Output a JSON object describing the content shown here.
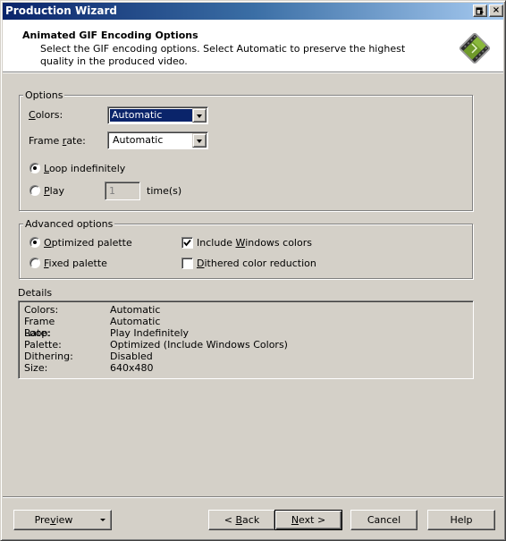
{
  "window": {
    "title": "Production Wizard",
    "restore_label": "restore",
    "close_label": "×"
  },
  "header": {
    "title": "Animated GIF Encoding Options",
    "description": "Select the GIF encoding options. Select Automatic to preserve the highest quality in the produced video.",
    "icon": "film-clip-icon"
  },
  "options": {
    "legend": "Options",
    "colors_label_accel": "C",
    "colors_label_rest": "olors:",
    "colors_value": "Automatic",
    "frame_rate_label_pre": "Frame ",
    "frame_rate_label_accel": "r",
    "frame_rate_label_rest": "ate:",
    "frame_rate_value": "Automatic",
    "loop_accel": "L",
    "loop_rest": "oop indefinitely",
    "loop_selected": true,
    "play_accel": "P",
    "play_rest": "lay",
    "play_selected": false,
    "play_times_value": "1",
    "times_suffix": "time(s)"
  },
  "advanced": {
    "legend": "Advanced options",
    "optimized_accel": "O",
    "optimized_rest": "ptimized palette",
    "optimized_selected": true,
    "fixed_accel": "F",
    "fixed_rest": "ixed palette",
    "fixed_selected": false,
    "include_windows_pre": "Include ",
    "include_windows_accel": "W",
    "include_windows_rest": "indows colors",
    "include_windows_checked": true,
    "dithered_accel": "D",
    "dithered_rest": "ithered color reduction",
    "dithered_checked": false
  },
  "details": {
    "label": "Details",
    "rows": [
      {
        "key": "Colors:",
        "value": "Automatic"
      },
      {
        "key": "Frame Rate:",
        "value": "Automatic"
      },
      {
        "key": "Loop:",
        "value": "Play Indefinitely"
      },
      {
        "key": "Palette:",
        "value": "Optimized (Include Windows Colors)"
      },
      {
        "key": "Dithering:",
        "value": "Disabled"
      },
      {
        "key": "Size:",
        "value": "640x480"
      }
    ]
  },
  "footer": {
    "preview_pre": "Pre",
    "preview_accel": "v",
    "preview_rest": "iew",
    "back_pre": "< ",
    "back_accel": "B",
    "back_rest": "ack",
    "next_accel": "N",
    "next_rest": "ext >",
    "cancel_label": "Cancel",
    "help_label": "Help"
  }
}
